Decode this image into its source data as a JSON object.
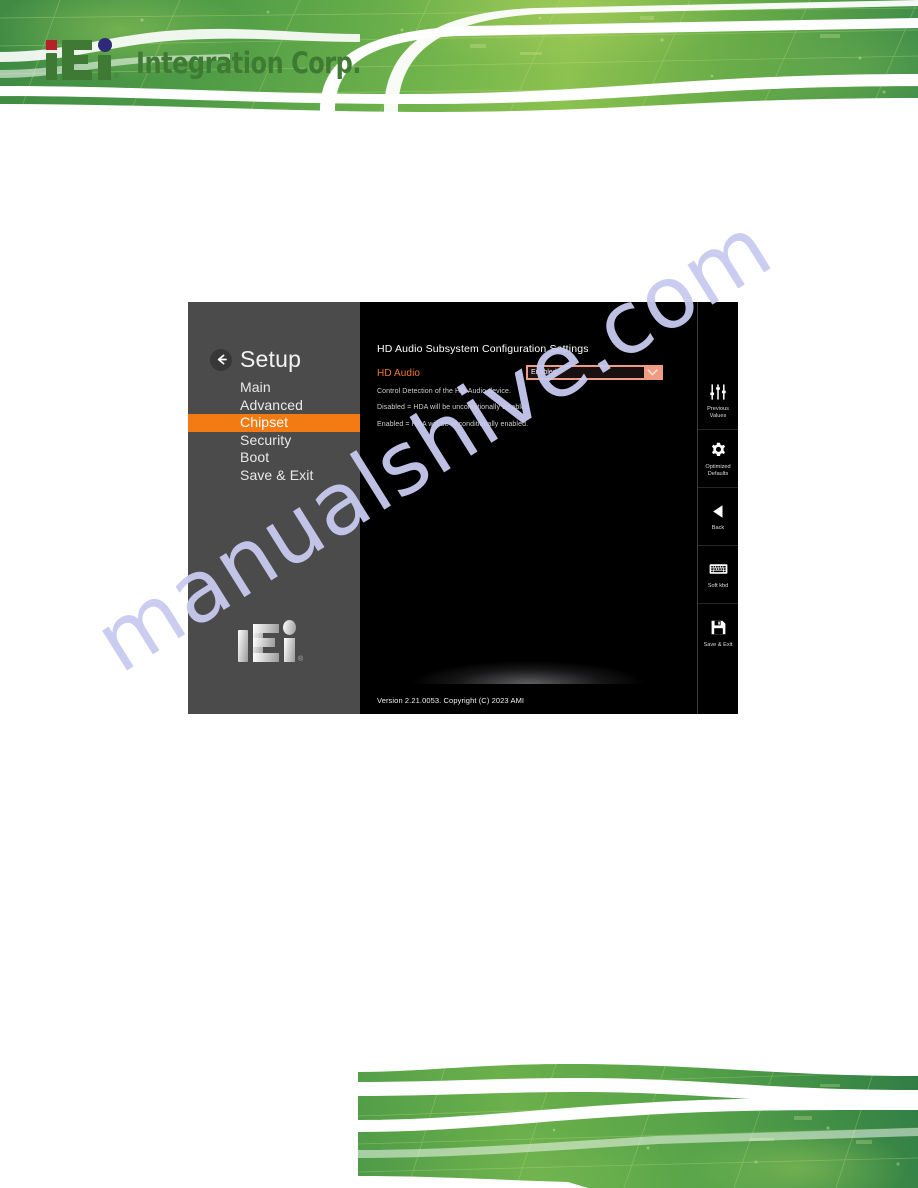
{
  "document": {
    "watermark": "manualshive.com"
  },
  "header": {
    "logo_text": "Integration Corp.",
    "logo_mark": "iei-logo-icon",
    "registered_mark": "®"
  },
  "bios": {
    "nav": {
      "back_icon": "back-arrow-icon",
      "title": "Setup",
      "items": [
        {
          "label": "Main",
          "active": false
        },
        {
          "label": "Advanced",
          "active": false
        },
        {
          "label": "Chipset",
          "active": true
        },
        {
          "label": "Security",
          "active": false
        },
        {
          "label": "Boot",
          "active": false
        },
        {
          "label": "Save & Exit",
          "active": false
        }
      ],
      "logo_mark": "iei-logo-icon",
      "registered_mark": "®"
    },
    "main": {
      "section_heading": "HD Audio Subsystem Configuration Settings",
      "setting_label": "HD Audio",
      "setting_value": "Enabled",
      "caret_icon": "chevron-down-icon",
      "help_lines": [
        "Control Detection of the HD-Audio device.",
        "Disabled = HDA will be unconditionally disabled",
        "Enabled = HDA will be unconditionally enabled."
      ],
      "version": "Version 2.21.0053. Copyright (C) 2023 AMI"
    },
    "toolbar": [
      {
        "label": "Previous\nValues",
        "icon": "sliders-icon"
      },
      {
        "label": "Optimized\nDefaults",
        "icon": "gear-icon"
      },
      {
        "label": "Back",
        "icon": "triangle-left-icon"
      },
      {
        "label": "Soft kbd",
        "icon": "keyboard-icon"
      },
      {
        "label": "Save & Exit",
        "icon": "floppy-disk-icon"
      }
    ]
  },
  "colors": {
    "accent_orange": "#f47b14",
    "label_orange": "#f4762e",
    "nav_gray": "#4b4b4b",
    "panel_black": "#000000",
    "dropdown_salmon": "#ef9c84",
    "brand_green": "#3e7a33",
    "watermark_blue": "#c9cbf0"
  }
}
